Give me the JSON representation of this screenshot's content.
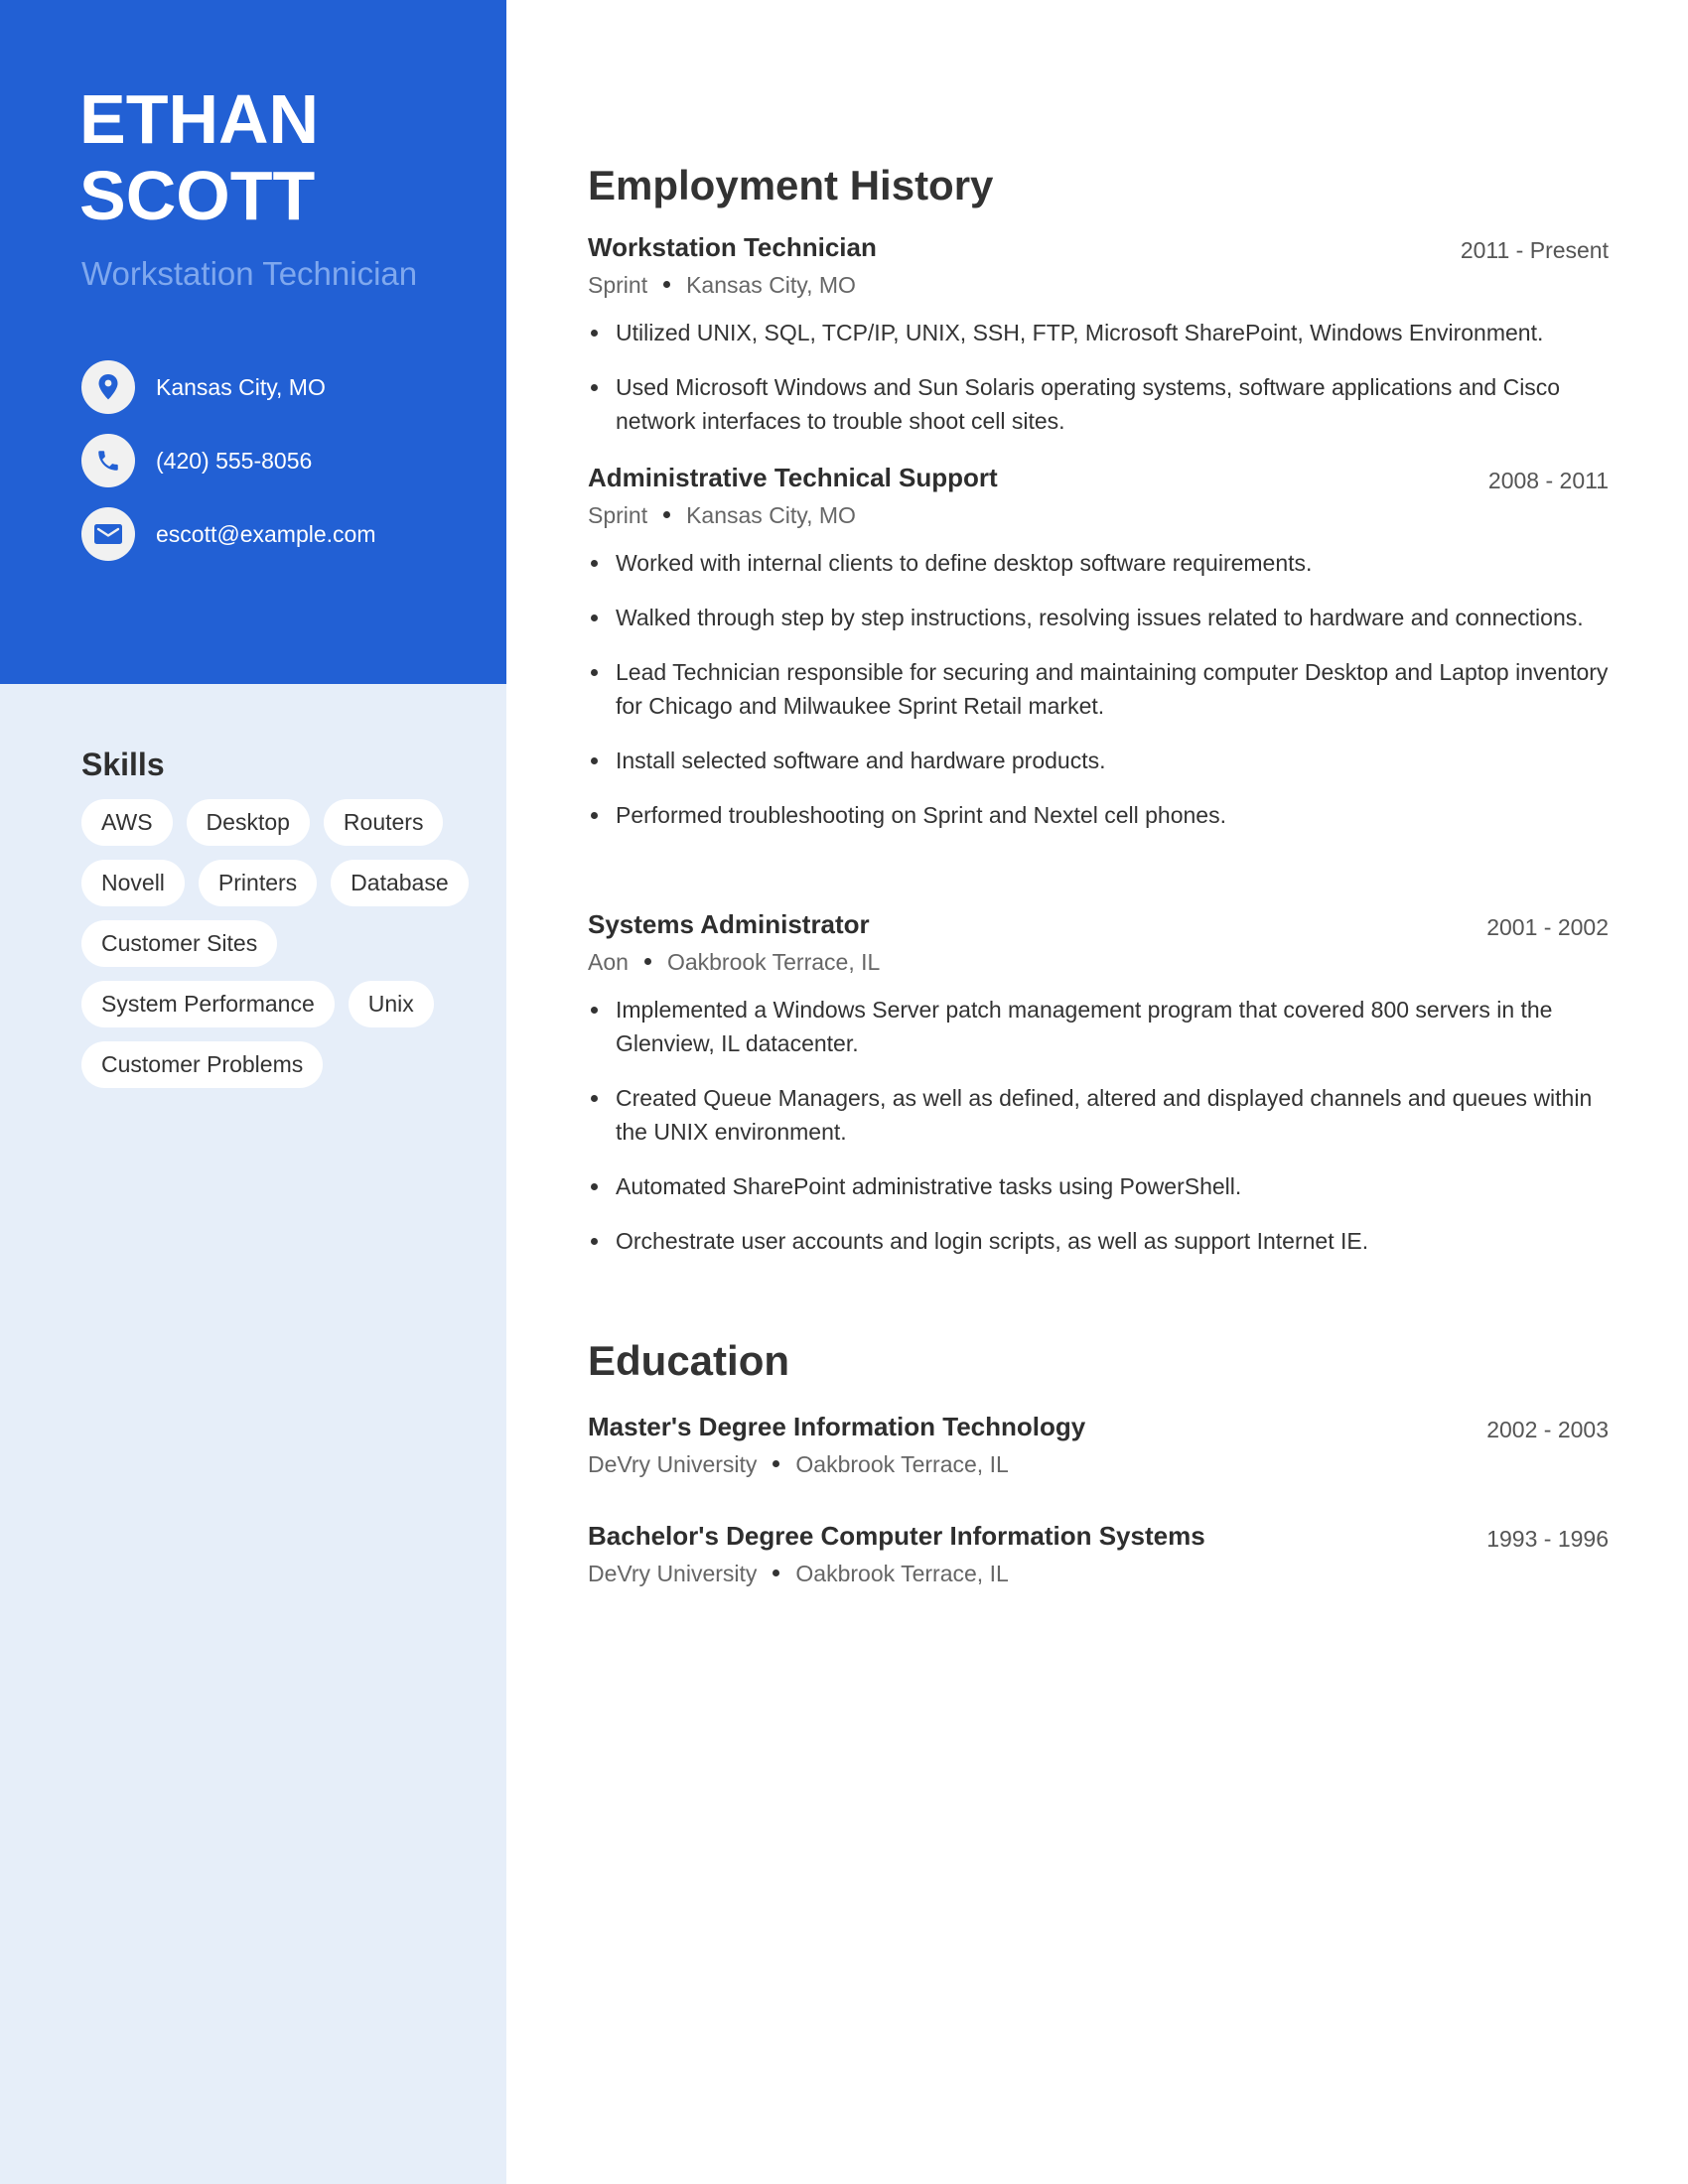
{
  "profile": {
    "first_name": "ETHAN",
    "last_name": "SCOTT",
    "title": "Workstation Technician",
    "contacts": [
      {
        "icon": "map-pin-icon",
        "text": "Kansas City, MO"
      },
      {
        "icon": "phone-icon",
        "text": "(420) 555-8056"
      },
      {
        "icon": "mail-icon",
        "text": "escott@example.com"
      }
    ]
  },
  "colors": {
    "accent": "#2260D4",
    "sidebar_bg": "#E6EEF9",
    "subtitle": "#7FA8EE",
    "text": "#333333"
  },
  "skills": {
    "title": "Skills",
    "items": [
      "AWS",
      "Desktop",
      "Routers",
      "Novell",
      "Printers",
      "Database",
      "Customer Sites",
      "System Performance",
      "Unix",
      "Customer Problems"
    ]
  },
  "employment": {
    "title": "Employment History",
    "jobs": [
      {
        "title": "Workstation Technician",
        "dates": "2011 - Present",
        "company": "Sprint",
        "location": "Kansas City, MO",
        "bullets": [
          "Utilized UNIX, SQL, TCP/IP, UNIX, SSH, FTP, Microsoft SharePoint, Windows Environment.",
          "Used Microsoft Windows and Sun Solaris operating systems, software applications and Cisco network interfaces to trouble shoot cell sites."
        ]
      },
      {
        "title": "Administrative Technical Support",
        "dates": "2008 - 2011",
        "company": "Sprint",
        "location": "Kansas City, MO",
        "bullets": [
          "Worked with internal clients to define desktop software requirements.",
          "Walked through step by step instructions, resolving issues related to hardware and connections.",
          "Lead Technician responsible for securing and maintaining computer Desktop and Laptop inventory for Chicago and Milwaukee Sprint Retail market.",
          "Install selected software and hardware products.",
          "Performed troubleshooting on Sprint and Nextel cell phones."
        ]
      },
      {
        "title": "Systems Administrator",
        "dates": "2001 - 2002",
        "company": "Aon",
        "location": "Oakbrook Terrace, IL",
        "bullets": [
          "Implemented a Windows Server patch management program that covered 800 servers in the Glenview, IL datacenter.",
          "Created Queue Managers, as well as defined, altered and displayed channels and queues within the UNIX environment.",
          "Automated SharePoint administrative tasks using PowerShell.",
          "Orchestrate user accounts and login scripts, as well as support Internet IE."
        ]
      }
    ]
  },
  "education": {
    "title": "Education",
    "entries": [
      {
        "degree": "Master's Degree Information Technology",
        "dates": "2002 - 2003",
        "school": "DeVry University",
        "location": "Oakbrook Terrace, IL"
      },
      {
        "degree": "Bachelor's Degree Computer Information Systems",
        "dates": "1993 - 1996",
        "school": "DeVry University",
        "location": "Oakbrook Terrace, IL"
      }
    ]
  }
}
